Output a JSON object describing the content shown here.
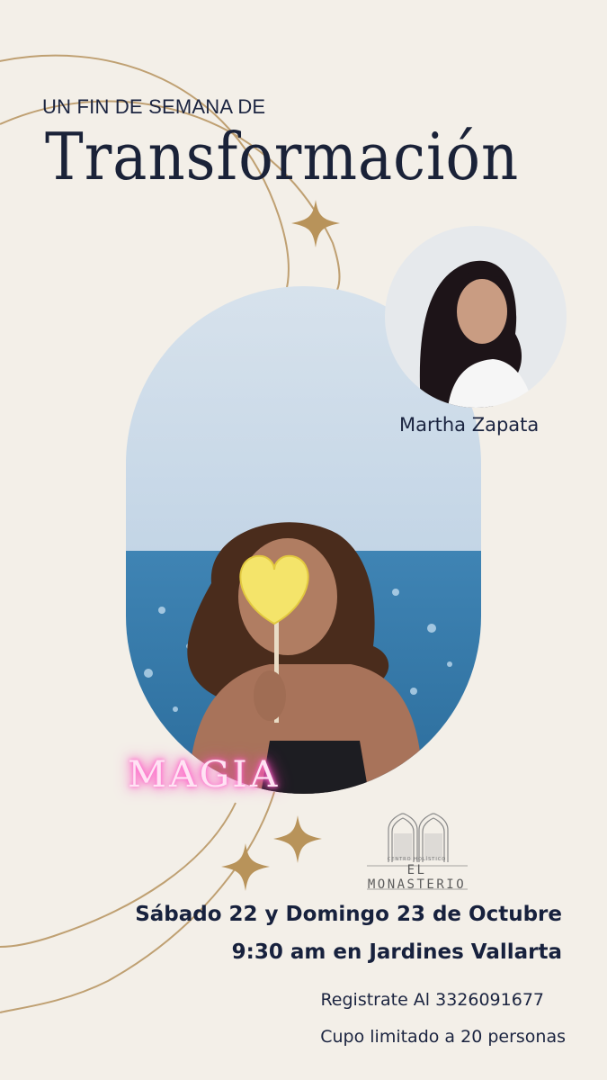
{
  "header": {
    "subtitle": "UN FIN DE SEMANA DE",
    "title": "Transformación"
  },
  "host": {
    "name": "Martha Zapata"
  },
  "overlay_word": "MAGIA",
  "logo": {
    "tagline": "CENTRO HOLÍSTICO",
    "name": "EL MONASTERIO"
  },
  "event": {
    "dates": "Sábado 22 y Domingo 23 de Octubre",
    "time_place": "9:30 am en Jardines Vallarta",
    "registration": "Registrate Al 3326091677",
    "capacity": "Cupo limitado a 20 personas"
  },
  "colors": {
    "background": "#f3efe8",
    "text": "#16203a",
    "accent_gold": "#b8935a",
    "neon_pink": "#ff4fc0"
  },
  "icons": [
    "sparkle-star-icon",
    "monastery-arch-logo"
  ]
}
